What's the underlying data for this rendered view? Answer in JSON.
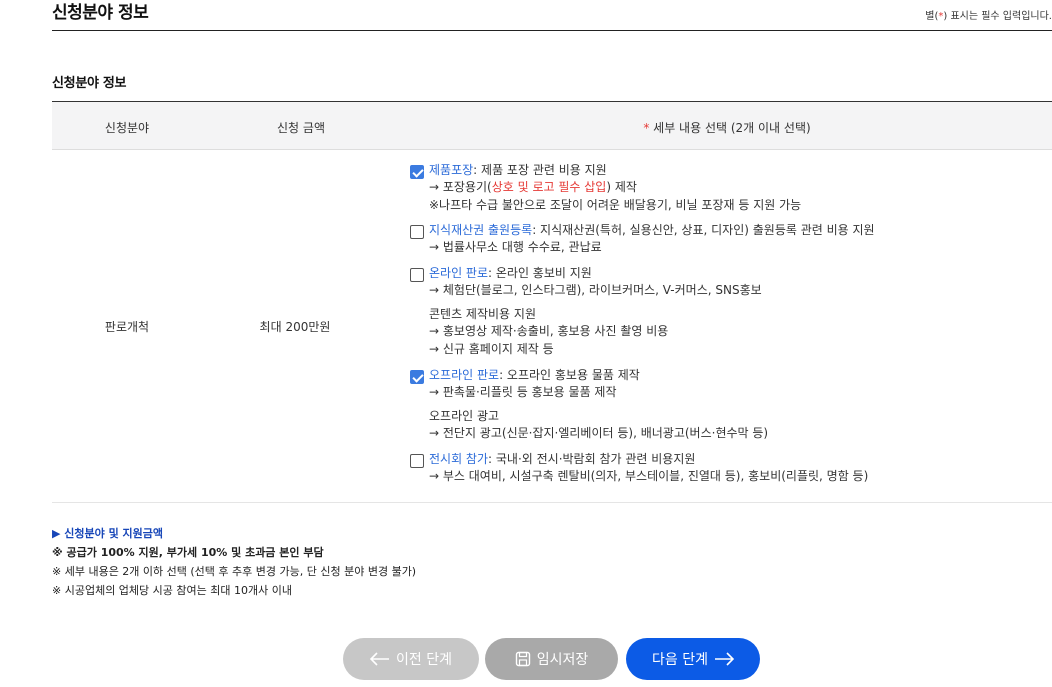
{
  "header": {
    "title": "신청분야 정보",
    "required_prefix": "별(",
    "required_star": "*",
    "required_suffix": ") 표시는 필수 입력입니다."
  },
  "section": {
    "title": "신청분야 정보"
  },
  "table": {
    "headers": {
      "field": "신청분야",
      "amount": "신청 금액",
      "detail_star": "*",
      "detail": " 세부 내용 선택 (2개 이내 선택)"
    },
    "row": {
      "field": "판로개척",
      "amount": "최대 200만원"
    },
    "options": [
      {
        "checked": true,
        "title": "제품포장",
        "desc": ": 제품 포장 관련 비용 지원",
        "sub1_pre": "→ 포장용기(",
        "sub1_red": "상호 및 로고 필수 삽입",
        "sub1_post": ") 제작",
        "sub2": "※나프타 수급 불안으로 조달이 어려운 배달용기, 비닐 포장재 등 지원 가능"
      },
      {
        "checked": false,
        "title": "지식재산권 출원등록",
        "desc": ": 지식재산권(특허, 실용신안, 상표, 디자인) 출원등록 관련 비용 지원",
        "sub1": "→ 법률사무소 대행 수수료, 관납료"
      },
      {
        "checked": false,
        "title": "온라인 판로",
        "desc": ": 온라인 홍보비 지원",
        "sub1": "→ 체험단(블로그, 인스타그램), 라이브커머스, V-커머스, SNS홍보",
        "sub2": "콘텐츠 제작비용 지원",
        "sub3": "→ 홍보영상 제작·송출비, 홍보용 사진 촬영 비용",
        "sub4": "→ 신규 홈페이지 제작 등"
      },
      {
        "checked": true,
        "title": "오프라인 판로",
        "desc": ": 오프라인 홍보용 물품 제작",
        "sub1": "→ 판촉물·리플릿 등 홍보용 물품 제작",
        "sub2": "오프라인 광고",
        "sub3": "→ 전단지 광고(신문·잡지·엘리베이터 등), 배너광고(버스·현수막 등)"
      },
      {
        "checked": false,
        "title": "전시회 참가",
        "desc": ": 국내·외 전시·박람회 참가 관련 비용지원",
        "sub1": "→ 부스 대여비, 시설구축 렌탈비(의자, 부스테이블, 진열대 등), 홍보비(리플릿, 명함 등)"
      }
    ]
  },
  "notes": {
    "title": "▶ 신청분야 및 지원금액",
    "line1": "※ 공급가 100% 지원, 부가세 10% 및 초과금 본인 부담",
    "line2": "※ 세부 내용은 2개 이하 선택 (선택 후 추후 변경 가능, 단 신청 분야 변경 불가)",
    "line3": "※ 시공업체의 업체당 시공 참여는 최대 10개사 이내"
  },
  "buttons": {
    "prev": "이전 단계",
    "save": "임시저장",
    "next": "다음 단계"
  },
  "icons": {
    "prev": "arrow-left-icon",
    "save": "save-icon",
    "next": "arrow-right-icon"
  },
  "colors": {
    "primary": "#0c5be6",
    "link": "#2c6bd8",
    "required": "#e53935",
    "disabled": "#c7c7c7"
  }
}
